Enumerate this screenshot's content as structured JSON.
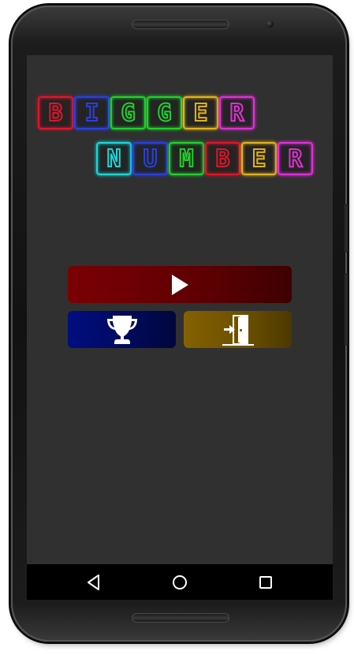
{
  "app": {
    "title_line1": [
      "B",
      "I",
      "G",
      "G",
      "E",
      "R"
    ],
    "title_line2": [
      "N",
      "U",
      "M",
      "B",
      "E",
      "R"
    ],
    "title_line1_colors": [
      "#e0152a",
      "#2a3fe0",
      "#1fd12a",
      "#1fd12a",
      "#e0b21a",
      "#e030d8"
    ],
    "title_line2_colors": [
      "#18d8d8",
      "#2a3fe0",
      "#1fd12a",
      "#e0152a",
      "#e0b21a",
      "#e030d8"
    ]
  },
  "menu": {
    "play_icon": "play-icon",
    "trophy_icon": "trophy-icon",
    "exit_icon": "exit-door-icon",
    "colors": {
      "play": "#7a0004",
      "trophy": "#000e80",
      "exit": "#846100"
    }
  },
  "navbar": {
    "back_icon": "back-icon",
    "home_icon": "home-icon",
    "recents_icon": "recents-icon"
  }
}
